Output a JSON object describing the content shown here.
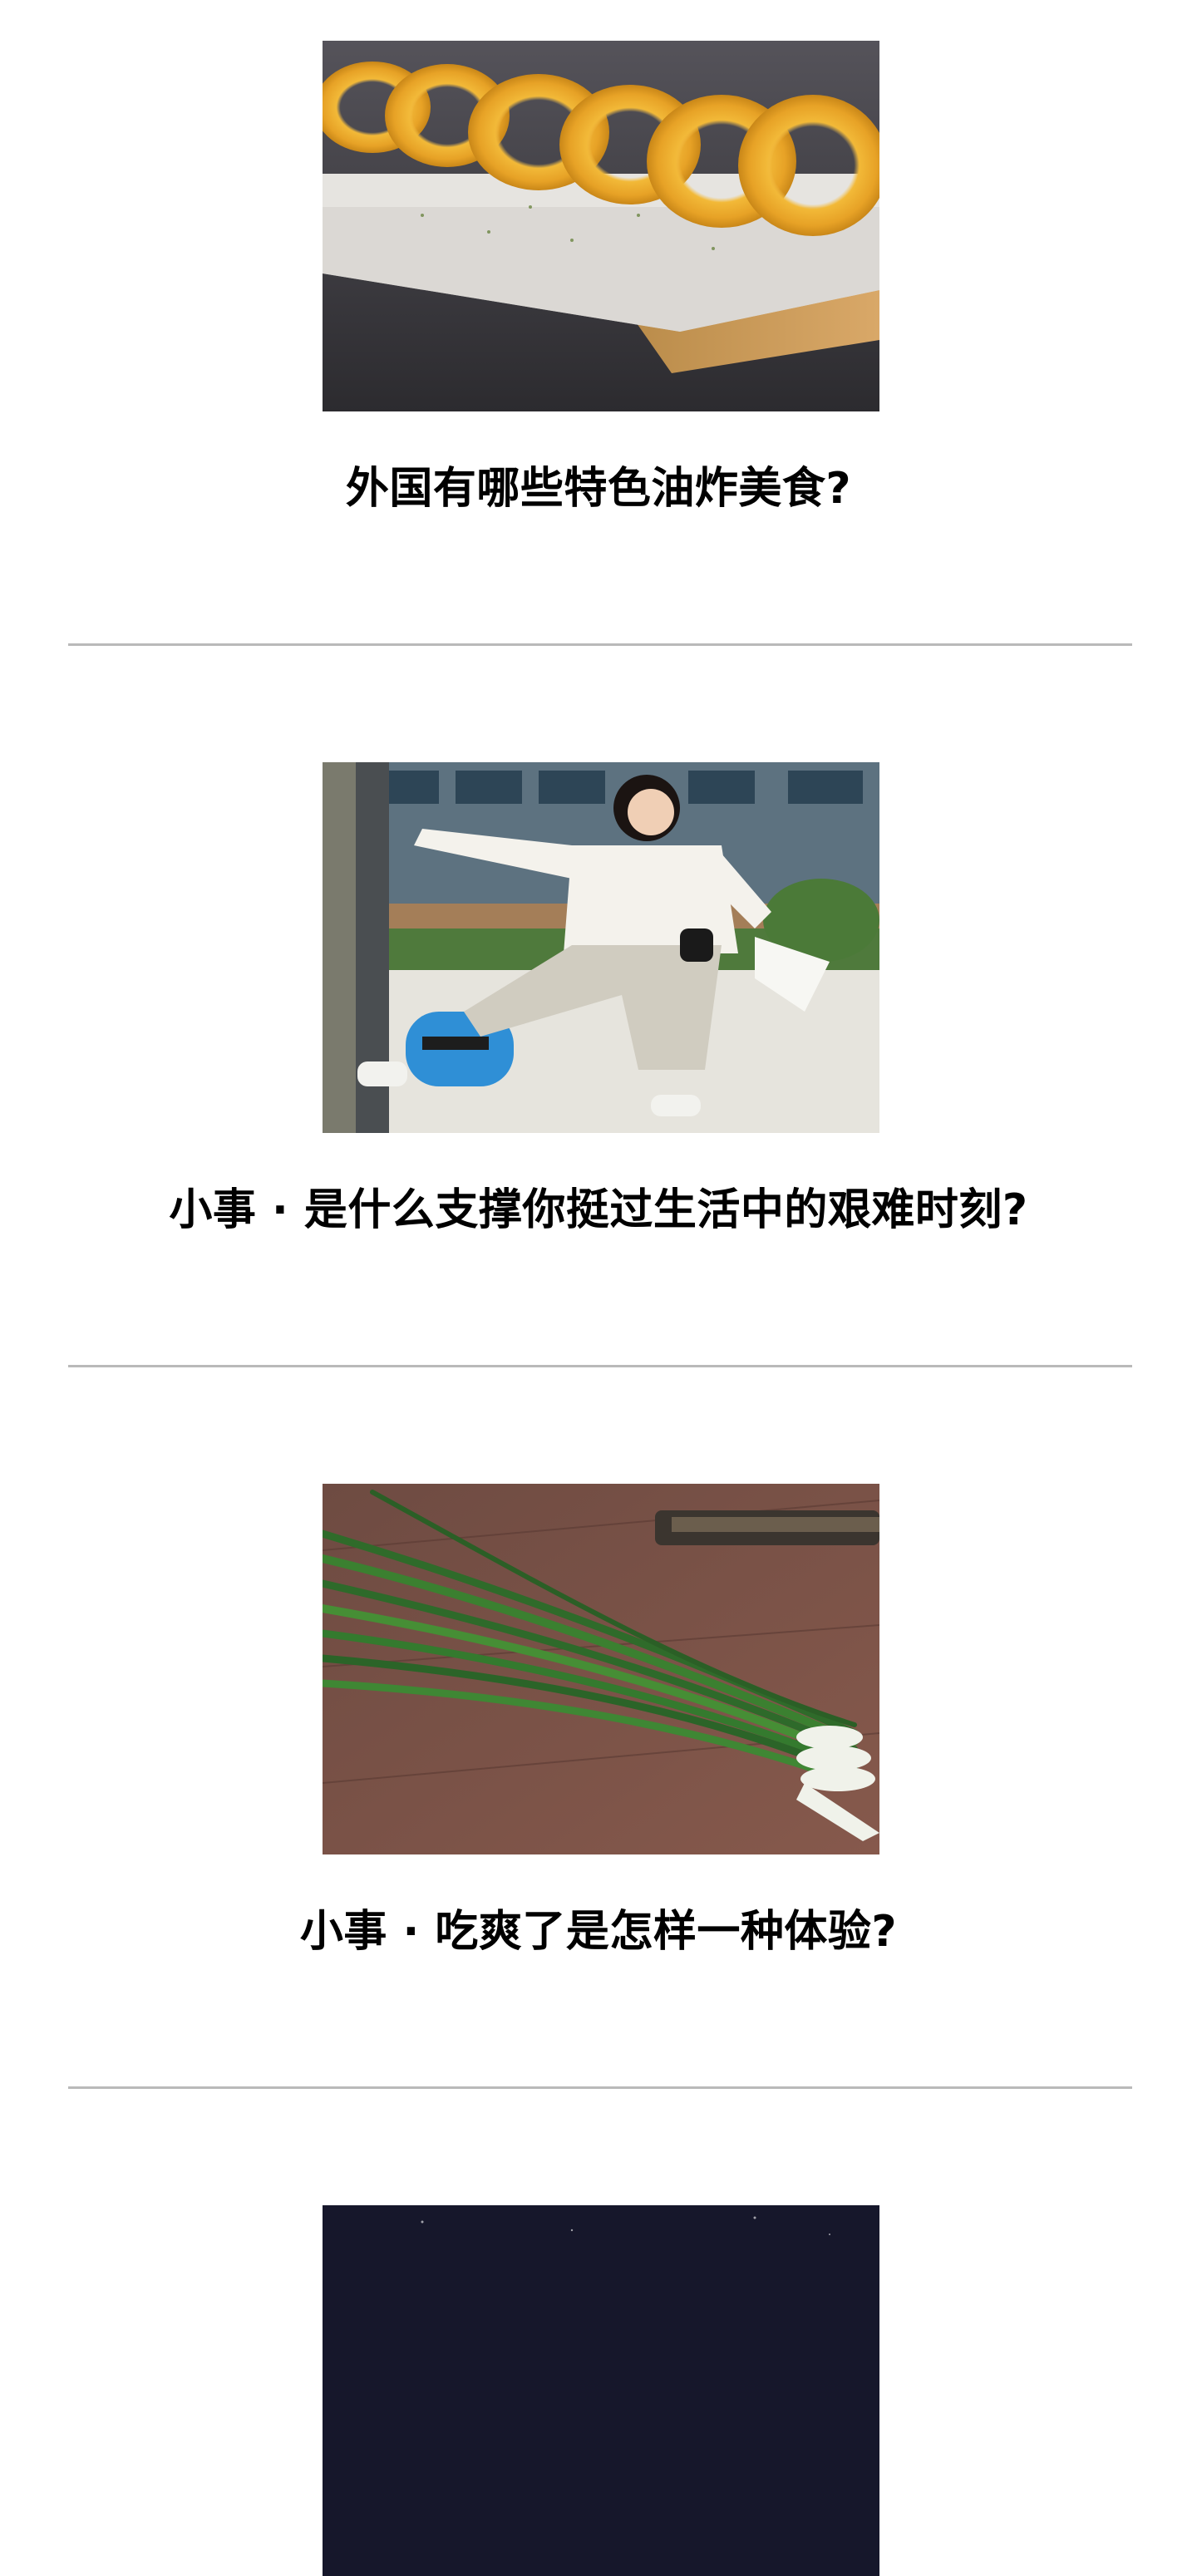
{
  "feed": {
    "articles": [
      {
        "title": "外国有哪些特色油炸美食?",
        "image_subject": "fried onion rings on paper on a wooden board"
      },
      {
        "title": "小事 · 是什么支撑你挺过生活中的艰难时刻?",
        "image_subject": "smiling woman with prosthetic leg leaning on a pole"
      },
      {
        "title": "小事 · 吃爽了是怎样一种体验?",
        "image_subject": "bunch of green onions on a wooden table"
      },
      {
        "title": "",
        "image_subject": "dark night sky"
      }
    ]
  },
  "colors": {
    "background": "#ffffff",
    "title_text": "#000000",
    "divider": "#b9b9b9"
  }
}
